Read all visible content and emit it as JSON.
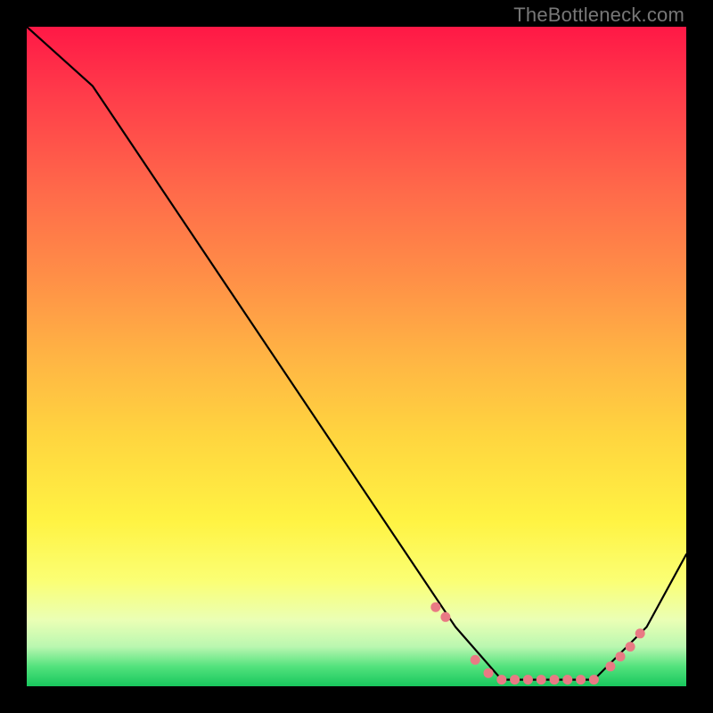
{
  "watermark": "TheBottleneck.com",
  "chart_data": {
    "type": "line",
    "title": "",
    "xlabel": "",
    "ylabel": "",
    "xlim": [
      0,
      100
    ],
    "ylim": [
      0,
      100
    ],
    "series": [
      {
        "name": "curve",
        "x": [
          0,
          10,
          65,
          72,
          86,
          94,
          100
        ],
        "y": [
          100,
          91,
          9,
          1,
          1,
          9,
          20
        ]
      }
    ],
    "markers": {
      "name": "highlight-dots",
      "color": "#e97a84",
      "x": [
        62,
        63.5,
        68,
        70,
        72,
        74,
        76,
        78,
        80,
        82,
        84,
        86,
        88.5,
        90,
        91.5,
        93
      ],
      "y": [
        12,
        10.5,
        4,
        2,
        1,
        1,
        1,
        1,
        1,
        1,
        1,
        1,
        3,
        4.5,
        6,
        8
      ]
    }
  }
}
